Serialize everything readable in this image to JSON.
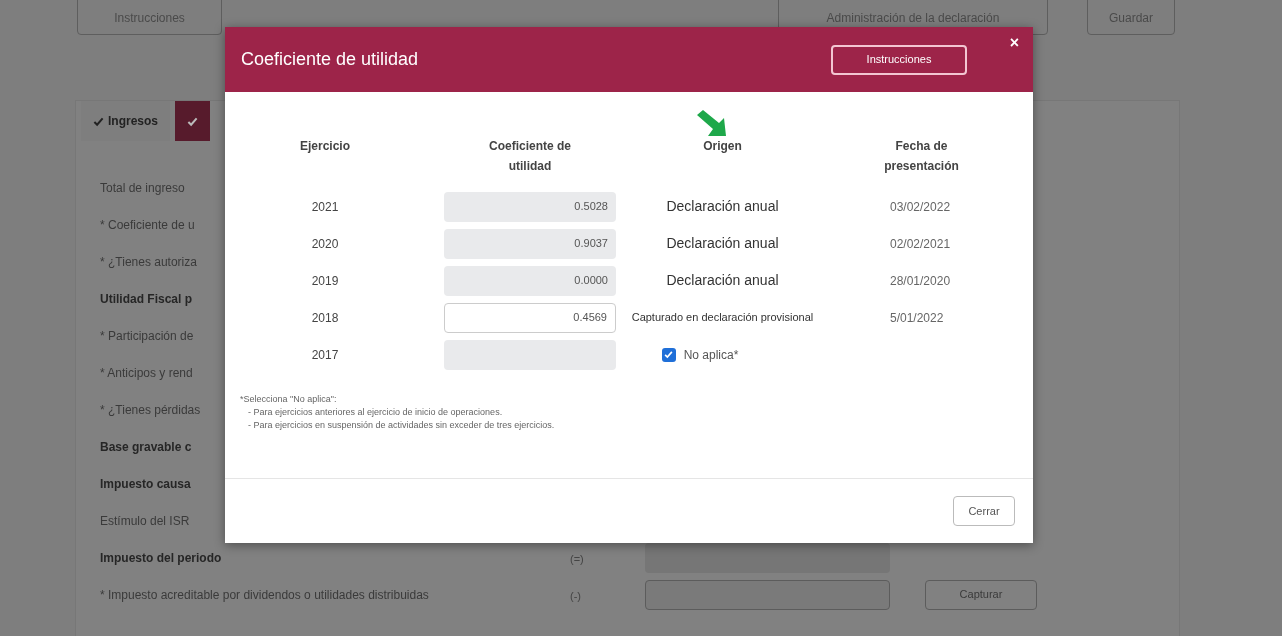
{
  "top_buttons": [
    {
      "label": "Instrucciones"
    },
    {
      "label": "Administración de la declaración"
    },
    {
      "label": "Guardar"
    }
  ],
  "tabs": [
    {
      "label": "Ingresos",
      "selected": false
    },
    {
      "selected": true
    }
  ],
  "form_rows": [
    {
      "label": "Total de ingreso",
      "bold": false
    },
    {
      "label": "* Coeficiente de u",
      "bold": false
    },
    {
      "label": "* ¿Tienes autoriza",
      "bold": false
    },
    {
      "label": "Utilidad Fiscal p",
      "bold": true
    },
    {
      "label": "* Participación de",
      "bold": false
    },
    {
      "label": "* Anticipos y rend",
      "bold": false
    },
    {
      "label": "* ¿Tienes pérdidas",
      "bold": false
    },
    {
      "label": "Base gravable c",
      "bold": true
    },
    {
      "label": "Impuesto causa",
      "bold": true
    },
    {
      "label": "Estímulo del ISR",
      "bold": false
    },
    {
      "label": "Impuesto del periodo",
      "bold": true,
      "sign": "(=)",
      "field": {
        "editable": false
      }
    },
    {
      "label": "* Impuesto acreditable por dividendos o utilidades distribuidas",
      "bold": false,
      "sign": "(-)",
      "field": {
        "editable": true
      },
      "button": "Capturar"
    }
  ],
  "modal": {
    "title": "Coeficiente de utilidad",
    "instructions_button": "Instrucciones",
    "close": "×",
    "columns": [
      "Ejercicio",
      "Coeficiente de utilidad",
      "Origen",
      "Fecha de presentación"
    ],
    "rows": [
      {
        "year": "2021",
        "value": "0.5028",
        "editable": false,
        "origin": "Declaración anual",
        "date": "03/02/2022"
      },
      {
        "year": "2020",
        "value": "0.9037",
        "editable": false,
        "origin": "Declaración anual",
        "date": "02/02/2021"
      },
      {
        "year": "2019",
        "value": "0.0000",
        "editable": false,
        "origin": "Declaración anual",
        "date": "28/01/2020"
      },
      {
        "year": "2018",
        "value": "0.4569",
        "editable": true,
        "origin": "Capturado en declaración provisional",
        "date": "5/01/2022"
      },
      {
        "year": "2017",
        "editable": false,
        "no_aplica": {
          "label": "No aplica*",
          "checked": true
        }
      }
    ],
    "footnote": [
      "*Selecciona \"No aplica\":",
      "- Para ejercicios anteriores al ejercicio de inicio de operaciones.",
      "- Para ejercicios en suspensión de actividades sin exceder de tres ejercicios."
    ],
    "close_button": "Cerrar"
  }
}
